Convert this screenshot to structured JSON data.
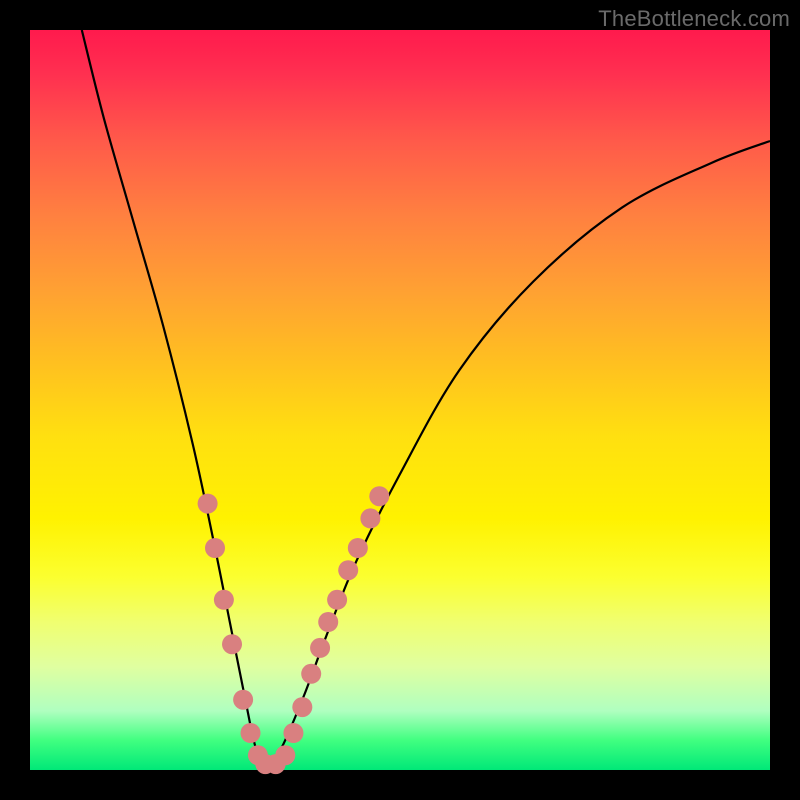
{
  "watermark": "TheBottleneck.com",
  "chart_data": {
    "type": "line",
    "title": "",
    "xlabel": "",
    "ylabel": "",
    "xlim": [
      0,
      100
    ],
    "ylim": [
      0,
      100
    ],
    "grid": false,
    "legend": false,
    "series": [
      {
        "name": "bottleneck-curve",
        "x": [
          7,
          10,
          14,
          18,
          22,
          25,
          27,
          29,
          30.5,
          32,
          34,
          37,
          40,
          44,
          50,
          58,
          68,
          80,
          92,
          100
        ],
        "values": [
          100,
          88,
          74,
          60,
          44,
          30,
          20,
          10,
          3,
          0,
          3,
          10,
          18,
          28,
          40,
          54,
          66,
          76,
          82,
          85
        ]
      }
    ],
    "markers": {
      "name": "highlight-dots",
      "color": "#d98080",
      "radius_px": 10,
      "points": [
        {
          "x": 24.0,
          "y": 36.0
        },
        {
          "x": 25.0,
          "y": 30.0
        },
        {
          "x": 26.2,
          "y": 23.0
        },
        {
          "x": 27.3,
          "y": 17.0
        },
        {
          "x": 28.8,
          "y": 9.5
        },
        {
          "x": 29.8,
          "y": 5.0
        },
        {
          "x": 30.8,
          "y": 2.0
        },
        {
          "x": 31.8,
          "y": 0.8
        },
        {
          "x": 33.2,
          "y": 0.8
        },
        {
          "x": 34.5,
          "y": 2.0
        },
        {
          "x": 35.6,
          "y": 5.0
        },
        {
          "x": 36.8,
          "y": 8.5
        },
        {
          "x": 38.0,
          "y": 13.0
        },
        {
          "x": 39.2,
          "y": 16.5
        },
        {
          "x": 40.3,
          "y": 20.0
        },
        {
          "x": 41.5,
          "y": 23.0
        },
        {
          "x": 43.0,
          "y": 27.0
        },
        {
          "x": 44.3,
          "y": 30.0
        },
        {
          "x": 46.0,
          "y": 34.0
        },
        {
          "x": 47.2,
          "y": 37.0
        }
      ]
    }
  }
}
